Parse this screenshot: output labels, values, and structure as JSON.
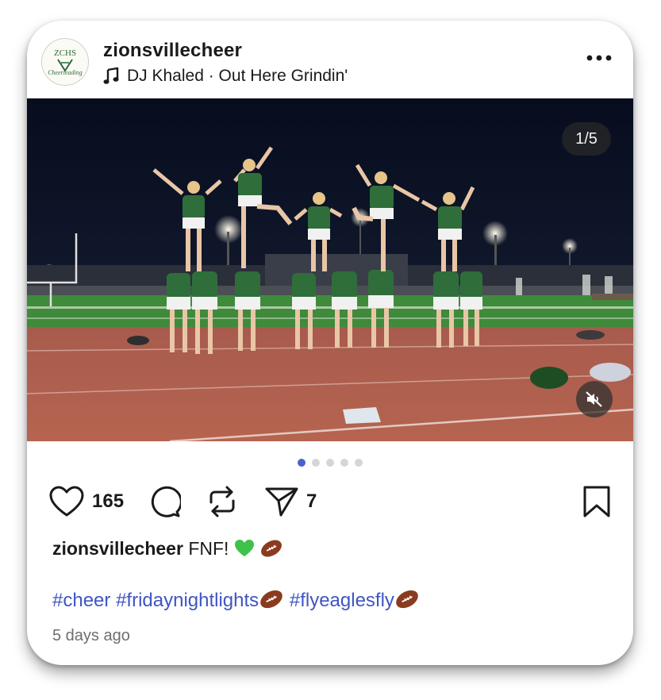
{
  "post": {
    "username": "zionsvillecheer",
    "audio": "DJ Khaled · Out Here Grindin'",
    "avatar_text": "ZCHS",
    "avatar_script": "Cheerleading",
    "media_counter": "1/5",
    "carousel": {
      "total": 5,
      "active": 1
    },
    "likes": "165",
    "shares": "7",
    "caption_user": "zionsvillecheer",
    "caption_text": "FNF!",
    "hashtags": [
      "#cheer",
      "#fridaynightlights",
      "#flyeaglesfly"
    ],
    "timestamp": "5 days ago"
  },
  "icons": {
    "more": "more-horizontal-icon",
    "music": "music-note-icon",
    "mute": "speaker-muted-icon",
    "like": "heart-icon",
    "comment": "comment-bubble-icon",
    "repost": "repost-arrows-icon",
    "share": "paper-plane-icon",
    "save": "bookmark-icon"
  },
  "colors": {
    "hashtag": "#3f55c4",
    "active_dot": "#4a63c9",
    "inactive_dot": "#d6d6d6",
    "sky": "#0a1224",
    "field_grass": "#3f8a3b",
    "track": "#b05a4c",
    "uniform_green": "#2f6e3a"
  }
}
